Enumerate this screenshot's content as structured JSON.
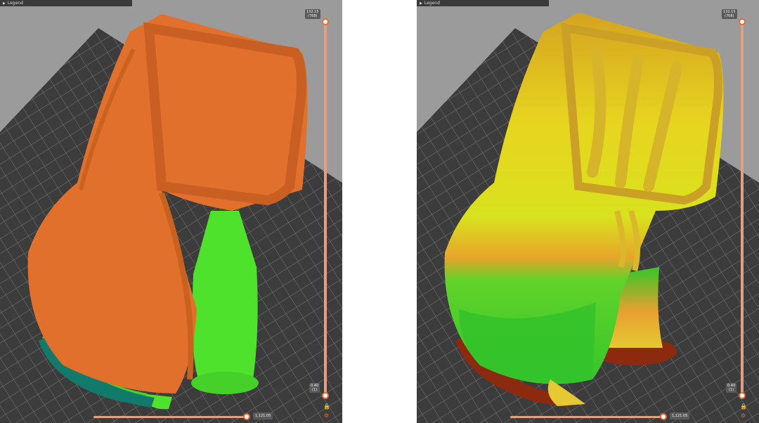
{
  "legend": {
    "label": "Legend",
    "icon": "triangle-right-icon"
  },
  "layer_slider": {
    "top_value": "132.15",
    "top_layer": "(768)",
    "bottom_value": "0.40",
    "bottom_layer": "(1)"
  },
  "move_slider": {
    "value": "1,121.05"
  },
  "icons": {
    "lock": "lock-icon",
    "settings": "gear-icon"
  },
  "colors": {
    "background": "#9b9b9b",
    "bed": "#3c3c3c",
    "grid": "#6e6e6e",
    "perimeter_orange": "#e0702c",
    "support_green": "#4fe22c",
    "gradient_yellow": "#e8d620",
    "first_layer_red": "#8c2a10",
    "slider_accent": "#e26b3a"
  }
}
